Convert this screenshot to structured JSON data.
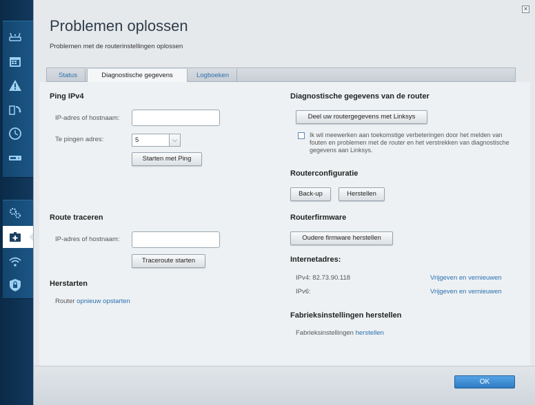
{
  "nav": {
    "icons": [
      "router-icon",
      "calendar-icon",
      "warning-icon",
      "update-icon",
      "clock-icon",
      "storage-icon",
      "settings-gears-icon",
      "diagnostics-icon",
      "wifi-icon",
      "security-icon"
    ],
    "active": "diagnostics-icon"
  },
  "dialog": {
    "close_label": "×",
    "title": "Problemen oplossen",
    "subtitle": "Problemen met de routerinstellingen oplossen"
  },
  "tabs": [
    {
      "label": "Status"
    },
    {
      "label": "Diagnostische gegevens"
    },
    {
      "label": "Logboeken"
    }
  ],
  "ping": {
    "heading": "Ping IPv4",
    "host_label": "IP-adres of hostnaam:",
    "host_value": "",
    "count_label": "Te pingen adres:",
    "count_value": "5",
    "count_arrow": "⌵",
    "start_button": "Starten met Ping"
  },
  "traceroute": {
    "heading": "Route traceren",
    "host_label": "IP-adres of hostnaam:",
    "host_value": "",
    "start_button": "Traceroute starten"
  },
  "restart": {
    "heading": "Herstarten",
    "prefix": "Router ",
    "link": "opnieuw opstarten"
  },
  "diag": {
    "heading": "Diagnostische gegevens van de router",
    "share_button": "Deel uw routergegevens met Linksys",
    "consent_text": "Ik wil meewerken aan toekomstige verbeteringen door het melden van fouten en problemen met de router en het verstrekken van diagnostische gegevens aan Linksys.",
    "consent_checked": false
  },
  "config": {
    "heading": "Routerconfiguratie",
    "backup_button": "Back-up",
    "restore_button": "Herstellen"
  },
  "firmware": {
    "heading": "Routerfirmware",
    "restore_button": "Oudere firmware herstellen"
  },
  "internet": {
    "heading": "Internetadres:",
    "ipv4_label": "IPv4: 82.73.90.118",
    "ipv4_link": "Vrijgeven en vernieuwen",
    "ipv6_label": "IPv6:",
    "ipv6_link": "Vrijgeven en vernieuwen"
  },
  "factory": {
    "heading": "Fabrieksinstellingen herstellen",
    "prefix": "Fabrieksinstellingen ",
    "link": "herstellen"
  },
  "footer": {
    "ok_button": "OK"
  },
  "colors": {
    "accent": "#2f7cc4",
    "link": "#2a6fb0",
    "nav_bg": "#12395e"
  }
}
